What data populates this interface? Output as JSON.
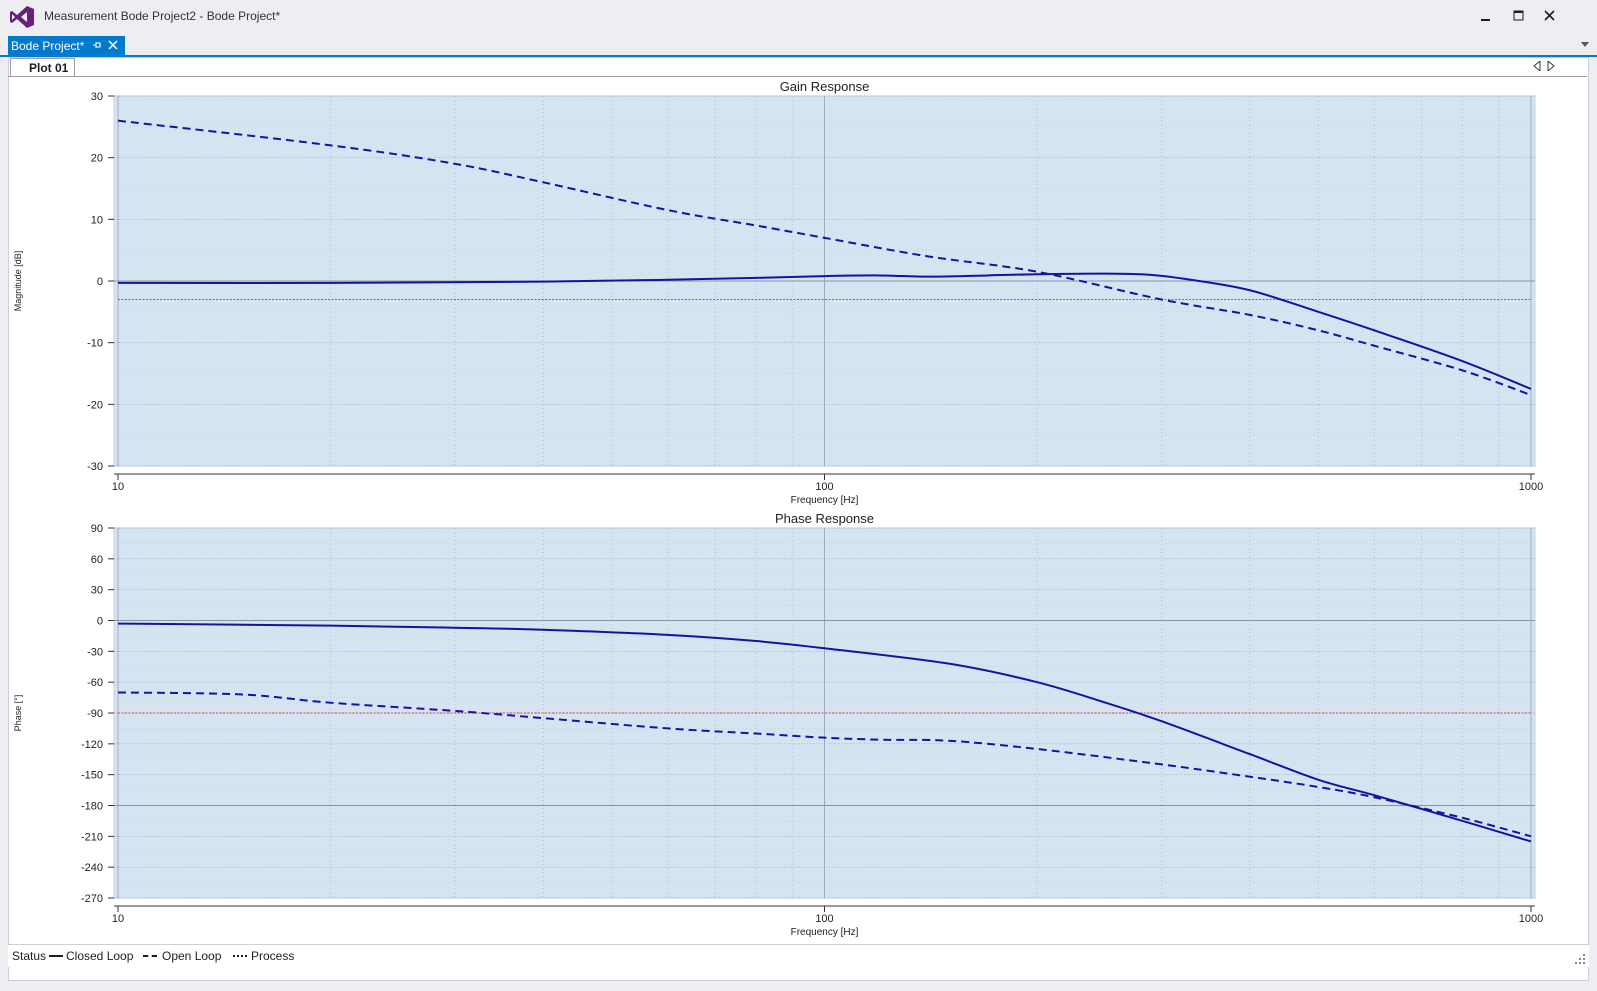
{
  "window": {
    "title": "Measurement Bode Project2 - Bode Project*",
    "doc_tab": "Bode Project*",
    "plot_tab": "Plot 01"
  },
  "colors": {
    "accent": "#007acc",
    "plot_bg": "#d6e4f2",
    "curve": "#1414a0",
    "reference": "#e04040"
  },
  "status": {
    "label": "Status",
    "legend": [
      {
        "label": "Closed Loop",
        "style": "solid"
      },
      {
        "label": "Open Loop",
        "style": "dashed"
      },
      {
        "label": "Process",
        "style": "dotted"
      }
    ]
  },
  "chart_data": [
    {
      "type": "line",
      "title": "Gain Response",
      "xlabel": "Frequency [Hz]",
      "ylabel": "Magnitude [dB]",
      "xscale": "log",
      "xlim": [
        10,
        1000
      ],
      "ylim": [
        -30,
        30
      ],
      "xticks": [
        "10",
        "100",
        "1000"
      ],
      "yticks": [
        "30",
        "20",
        "10",
        "0",
        "-10",
        "-20",
        "-30"
      ],
      "grid": true,
      "reference_line": -3,
      "series": [
        {
          "name": "Closed Loop",
          "style": "solid",
          "x": [
            10,
            20,
            40,
            60,
            80,
            100,
            120,
            140,
            170,
            200,
            250,
            290,
            330,
            400,
            500,
            600,
            800,
            1000
          ],
          "y": [
            -0.3,
            -0.3,
            -0.1,
            0.2,
            0.5,
            0.8,
            0.9,
            0.7,
            0.9,
            1.1,
            1.2,
            1.0,
            0.2,
            -1.5,
            -5.0,
            -8.0,
            -13.0,
            -17.5
          ]
        },
        {
          "name": "Open Loop",
          "style": "dashed",
          "x": [
            10,
            20,
            30,
            40,
            60,
            80,
            100,
            140,
            200,
            300,
            400,
            500,
            600,
            800,
            1000
          ],
          "y": [
            26.0,
            22.0,
            19.0,
            16.0,
            11.5,
            9.0,
            7.0,
            4.0,
            1.5,
            -3.0,
            -5.5,
            -8.0,
            -10.5,
            -14.5,
            -18.5
          ]
        }
      ]
    },
    {
      "type": "line",
      "title": "Phase Response",
      "xlabel": "Frequency [Hz]",
      "ylabel": "Phase [°]",
      "xscale": "log",
      "xlim": [
        10,
        1000
      ],
      "ylim": [
        -270,
        90
      ],
      "xticks": [
        "10",
        "100",
        "1000"
      ],
      "yticks": [
        "90",
        "60",
        "30",
        "0",
        "-30",
        "-60",
        "-90",
        "-120",
        "-150",
        "-180",
        "-210",
        "-240",
        "-270"
      ],
      "grid": true,
      "reference_line": -90,
      "series": [
        {
          "name": "Closed Loop",
          "style": "solid",
          "x": [
            10,
            20,
            30,
            40,
            60,
            80,
            100,
            150,
            200,
            250,
            300,
            400,
            500,
            600,
            800,
            1000
          ],
          "y": [
            -3,
            -5,
            -7,
            -9,
            -14,
            -20,
            -27,
            -42,
            -60,
            -80,
            -98,
            -130,
            -155,
            -170,
            -195,
            -215
          ]
        },
        {
          "name": "Open Loop",
          "style": "dashed",
          "x": [
            10,
            15,
            20,
            30,
            40,
            60,
            80,
            100,
            120,
            150,
            200,
            300,
            400,
            500,
            600,
            800,
            1000
          ],
          "y": [
            -70,
            -72,
            -80,
            -88,
            -95,
            -105,
            -110,
            -114,
            -116,
            -117,
            -125,
            -140,
            -152,
            -162,
            -172,
            -192,
            -210
          ]
        }
      ]
    }
  ]
}
